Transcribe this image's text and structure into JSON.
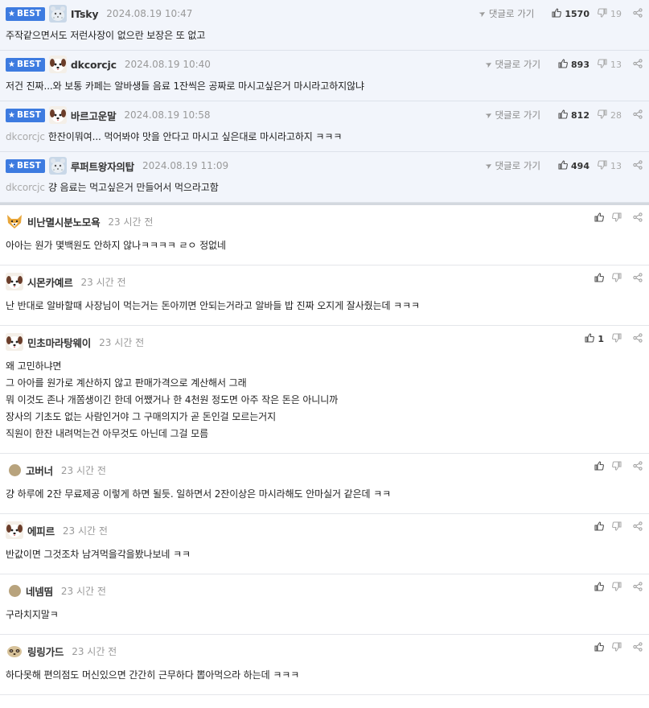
{
  "labels": {
    "best_badge": "BEST",
    "goto_reply": "댓글로 가기"
  },
  "colors": {
    "best_badge": "#3d7be0",
    "best_bg": "#f2f5fb"
  },
  "best_comments": [
    {
      "nick": "ITsky",
      "date": "2024.08.19 10:47",
      "reply_to": "",
      "text": "주작같으면서도 저런사장이 없으란 보장은 또 없고",
      "likes": "1570",
      "dislikes": "19",
      "avatar": "snow-leopard"
    },
    {
      "nick": "dkcorcjc",
      "date": "2024.08.19 10:40",
      "reply_to": "",
      "text": "저건 진짜...와 보통 카페는 알바생들 음료 1잔씩은 공짜로 마시고싶은거 마시라고하지않냐",
      "likes": "893",
      "dislikes": "13",
      "avatar": "puppy"
    },
    {
      "nick": "바르고운말",
      "date": "2024.08.19 10:58",
      "reply_to": "dkcorcjc",
      "text": "한잔이뭐여... 먹어봐야 맛을 안다고 마시고 싶은대로 마시라고하지 ㅋㅋㅋ",
      "likes": "812",
      "dislikes": "28",
      "avatar": "puppy"
    },
    {
      "nick": "루퍼트왕자의탑",
      "date": "2024.08.19 11:09",
      "reply_to": "dkcorcjc",
      "text": "걍 음료는 먹고싶은거 만들어서 먹으라고함",
      "likes": "494",
      "dislikes": "13",
      "avatar": "snow-leopard"
    }
  ],
  "comments": [
    {
      "nick": "비난멸시분노모욕",
      "date": "23 시간 전",
      "lines": [
        "아아는 원가 몇백원도 안하지 않나ㅋㅋㅋㅋ ㄹㅇ 정없네"
      ],
      "likes": "",
      "avatar": "shiba"
    },
    {
      "nick": "시몬카예르",
      "date": "23 시간 전",
      "lines": [
        "난 반대로 알바할때 사장님이 먹는거는 돈아끼면 안되는거라고 알바들 밥 진짜 오지게 잘사줬는데 ㅋㅋㅋ"
      ],
      "likes": "",
      "avatar": "puppy"
    },
    {
      "nick": "민초마라탕웨이",
      "date": "23 시간 전",
      "lines": [
        "왜 고민하냐면",
        "그 아아를 원가로 계산하지 않고 판매가격으로 계산해서 그래",
        "뭐 이것도 존나 개쫌생이긴 한데 어쨌거나 한 4천원 정도면 아주 작은 돈은 아니니까",
        "장사의 기초도 없는 사람인거야 그 구매의지가 곧 돈인걸 모르는거지",
        "직원이 한잔 내려먹는건 아무것도 아닌데 그걸 모름"
      ],
      "likes": "1",
      "avatar": "puppy"
    },
    {
      "nick": "고버너",
      "date": "23 시간 전",
      "lines": [
        "걍 하루에 2잔 무료제공 이렇게 하면 될듯. 일하면서 2잔이상은 마시라해도 안마실거 같은데 ㅋㅋ"
      ],
      "likes": "",
      "avatar": "dot"
    },
    {
      "nick": "에피르",
      "date": "23 시간 전",
      "lines": [
        "반값이면 그것조차 남겨먹을각을봤나보네 ㅋㅋ"
      ],
      "likes": "",
      "avatar": "puppy"
    },
    {
      "nick": "네넴띰",
      "date": "23 시간 전",
      "lines": [
        "구라치지말ㅋ"
      ],
      "likes": "",
      "avatar": "dot"
    },
    {
      "nick": "링링가드",
      "date": "23 시간 전",
      "lines": [
        "하다못해 편의점도 머신있으면 간간히 근무하다 뽑아먹으라 하는데 ㅋㅋㅋ"
      ],
      "likes": "",
      "avatar": "meerkat"
    }
  ]
}
